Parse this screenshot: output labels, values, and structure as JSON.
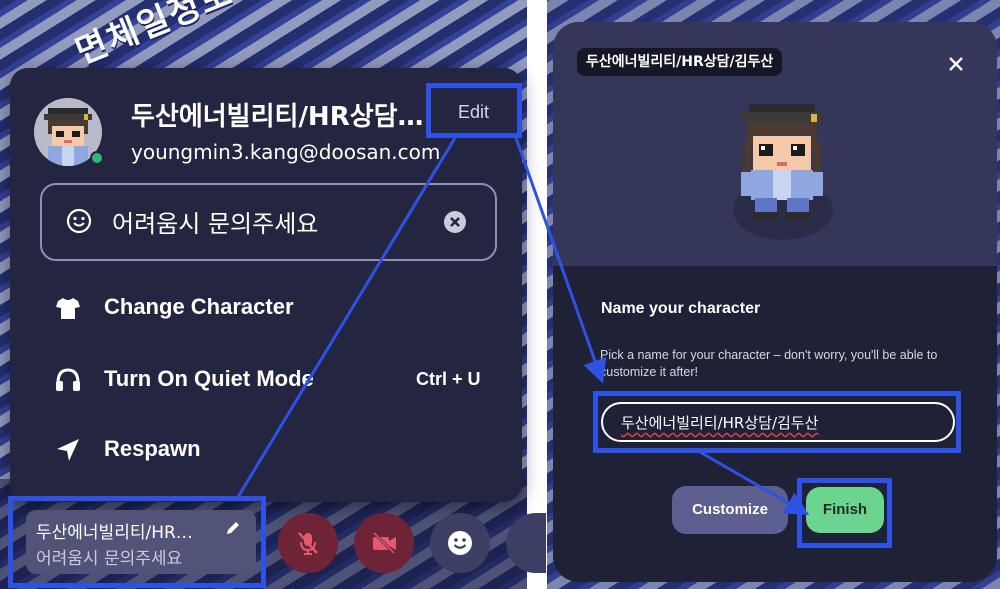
{
  "left": {
    "background_sign": "면체일정보",
    "profile": {
      "display_name": "두산에너빌리티/HR상담…",
      "email": "youngmin3.kang@doosan.com",
      "edit_label": "Edit"
    },
    "status": {
      "text": "어려움시 문의주세요"
    },
    "menu": [
      {
        "label": "Change Character",
        "icon": "tshirt-icon"
      },
      {
        "label": "Turn On Quiet Mode",
        "icon": "headphones-icon",
        "shortcut": "Ctrl + U"
      },
      {
        "label": "Respawn",
        "icon": "navigation-arrow-icon"
      }
    ],
    "toolbar": {
      "chip_name": "두산에너빌리티/HR…",
      "chip_status": "어려움시 문의주세요"
    }
  },
  "right": {
    "name_pill": "두산에너빌리티/HR상담/김두산",
    "heading": "Name your character",
    "help": "Pick a name for your character – don't worry, you'll be able to customize it after!",
    "input_value": "두산에너빌리티/HR상담/김두산",
    "customize_label": "Customize",
    "finish_label": "Finish"
  },
  "colors": {
    "highlight": "#2e52e6",
    "panel": "#232541",
    "finish": "#6bd48e",
    "customize": "#5c5f8f",
    "online": "#2dbb73"
  }
}
